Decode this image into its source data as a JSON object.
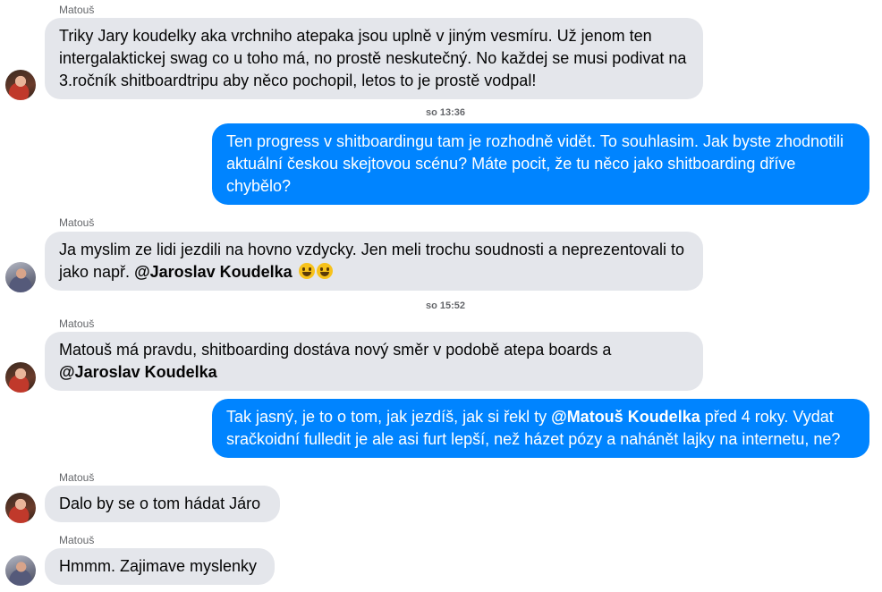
{
  "messages": [
    {
      "sender": "Matouš",
      "text": "Triky Jary koudelky aka vrchniho atepaka jsou uplně v jiným vesmíru. Už jenom ten intergalaktickej swag co u toho má, no prostě neskutečný. No  každej se musi podivat na 3.ročník shitboardtripu aby něco pochopil, letos to je prostě vodpal!"
    },
    {
      "timestamp": "so 13:36"
    },
    {
      "outgoing": true,
      "text": "Ten progress v shitboardingu tam je rozhodně vidět. To souhlasim. Jak byste zhodnotili aktuální českou skejtovou scénu? Máte pocit, že tu něco jako shitboarding dříve chybělo?"
    },
    {
      "sender": "Matouš",
      "text": "Ja myslim ze lidi jezdili na hovno vzdycky. Jen meli trochu soudnosti a neprezentovali to jako např. ",
      "mention": "@Jaroslav Koudelka"
    },
    {
      "timestamp": "so 15:52"
    },
    {
      "sender": "Matouš",
      "text": "Matouš má pravdu,  shitboarding dostáva nový směr v podobě atepa boards a ",
      "mention": "@Jaroslav Koudelka"
    },
    {
      "outgoing": true,
      "text_a": "Tak jasný, je to o tom, jak jezdíš, jak si řekl ty ",
      "mention": "@Matouš Koudelka",
      "text_b": " před 4 roky. Vydat sračkoidní fulledit je ale asi furt lepší, než házet pózy a nahánět lajky na internetu, ne?"
    },
    {
      "sender": "Matouš",
      "text": "Dalo by se o tom hádat Járo"
    },
    {
      "sender": "Matouš",
      "text": "Hmmm. Zajimave myslenky"
    }
  ],
  "icons": {
    "emoji": "grinning-face-emoji",
    "avatar": "user-avatar"
  },
  "colors": {
    "outgoing_bubble": "#0084ff",
    "incoming_bubble": "#e4e6eb"
  }
}
